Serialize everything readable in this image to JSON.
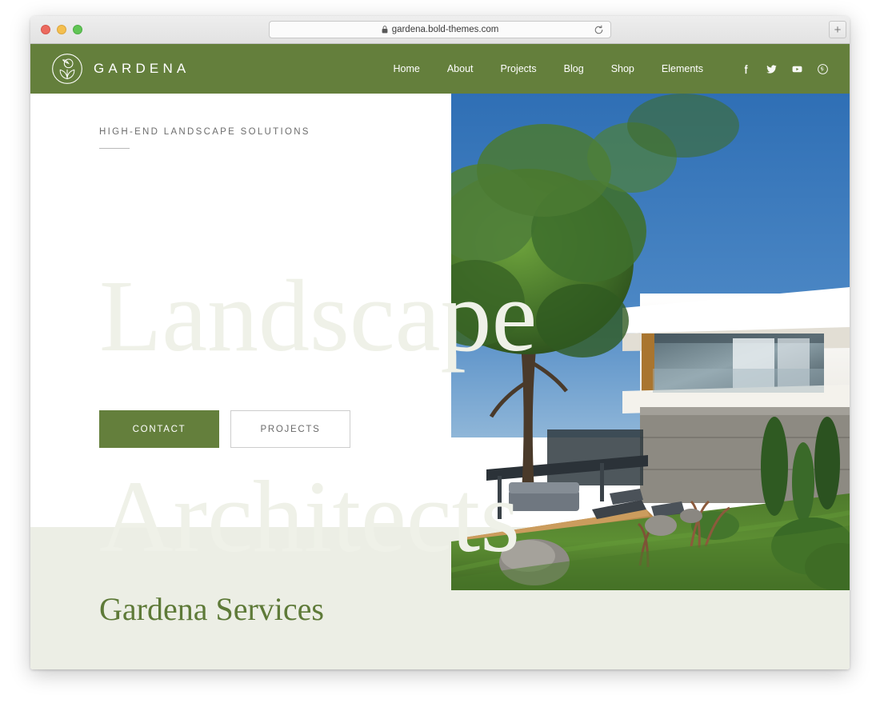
{
  "browser": {
    "url": "gardena.bold-themes.com",
    "lock_icon": "lock-icon",
    "reload_icon": "reload-icon",
    "newtab_label": "+",
    "traffic_lights": [
      "close-red",
      "minimize-yellow",
      "zoom-green"
    ]
  },
  "site": {
    "brand": {
      "name": "GARDENA",
      "logo_icon": "gardena-circular-leaf-logo"
    },
    "nav": [
      {
        "label": "Home",
        "name": "nav-home"
      },
      {
        "label": "About",
        "name": "nav-about"
      },
      {
        "label": "Projects",
        "name": "nav-projects"
      },
      {
        "label": "Blog",
        "name": "nav-blog"
      },
      {
        "label": "Shop",
        "name": "nav-shop"
      },
      {
        "label": "Elements",
        "name": "nav-elements"
      }
    ],
    "social": [
      {
        "name": "facebook-icon",
        "label": "Facebook"
      },
      {
        "name": "twitter-icon",
        "label": "Twitter"
      },
      {
        "name": "youtube-icon",
        "label": "YouTube"
      },
      {
        "name": "pinterest-icon",
        "label": "Pinterest"
      }
    ]
  },
  "hero": {
    "eyebrow": "HIGH-END LANDSCAPE SOLUTIONS",
    "title_line1": "Landscape",
    "title_line2": "Architects",
    "buttons": {
      "primary": "CONTACT",
      "secondary": "PROJECTS"
    },
    "image_alt": "Modern white villa with pool, lawn and trees"
  },
  "services": {
    "heading": "Gardena Services"
  },
  "colors": {
    "brand_green": "#647F3C",
    "heading_green": "#5E7A38",
    "sage_band": "#ECEEE5",
    "hero_title": "#EFF1E8",
    "eyebrow_gray": "#6D6D6D"
  }
}
